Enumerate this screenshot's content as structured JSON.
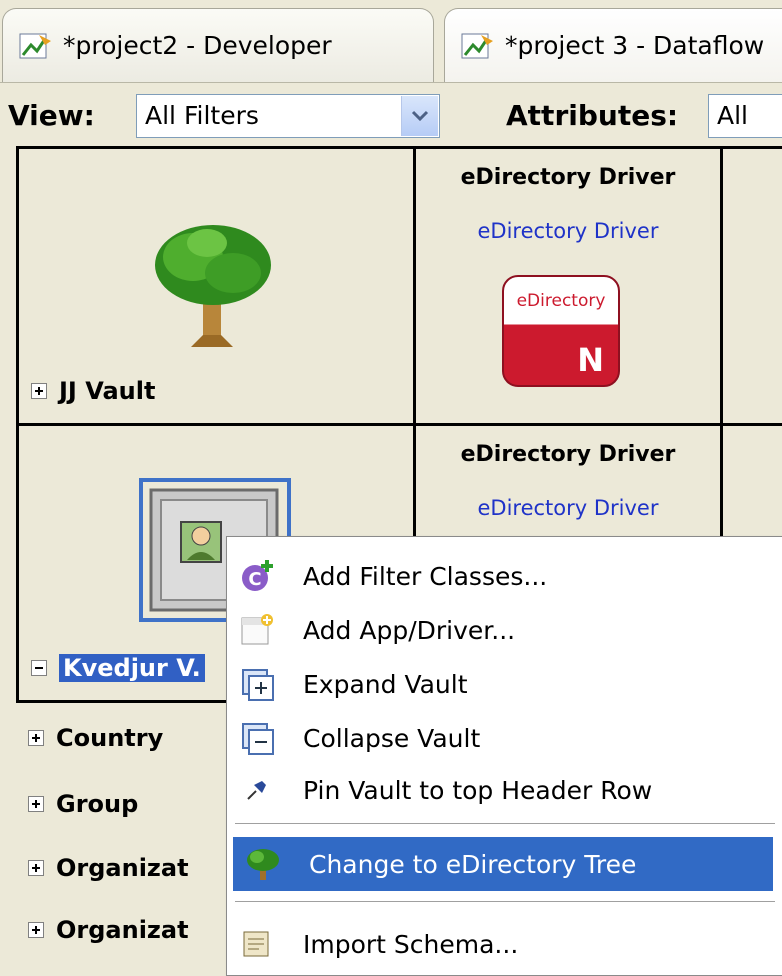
{
  "tabs": [
    {
      "label": "*project2 - Developer"
    },
    {
      "label": "*project 3 - Dataflow"
    }
  ],
  "toolbar": {
    "view_label": "View:",
    "view_value": "All Filters",
    "attributes_label": "Attributes:",
    "attributes_value": "All"
  },
  "grid": {
    "row1": {
      "vault": "JJ Vault",
      "driver_header": "eDirectory Driver",
      "driver_link": "eDirectory Driver",
      "logo_text": "eDirectory",
      "logo_letter": "N"
    },
    "row2": {
      "vault": "Kvedjur V.",
      "driver_header": "eDirectory Driver",
      "driver_link": "eDirectory Driver"
    },
    "classes": [
      "Country",
      "Group",
      "Organizat",
      "Organizat"
    ]
  },
  "context_menu": {
    "items": [
      {
        "label": "Add Filter Classes...",
        "icon": "add-class-icon"
      },
      {
        "label": "Add App/Driver...",
        "icon": "add-app-icon"
      },
      {
        "label": "Expand Vault",
        "icon": "expand-icon"
      },
      {
        "label": "Collapse Vault",
        "icon": "collapse-icon"
      },
      {
        "label": "Pin Vault to top Header Row",
        "icon": "pin-icon"
      },
      {
        "label": "Change to eDirectory Tree",
        "icon": "tree-icon"
      },
      {
        "label": "Import Schema...",
        "icon": "schema-icon"
      }
    ],
    "highlight_color": "#316ac5"
  }
}
